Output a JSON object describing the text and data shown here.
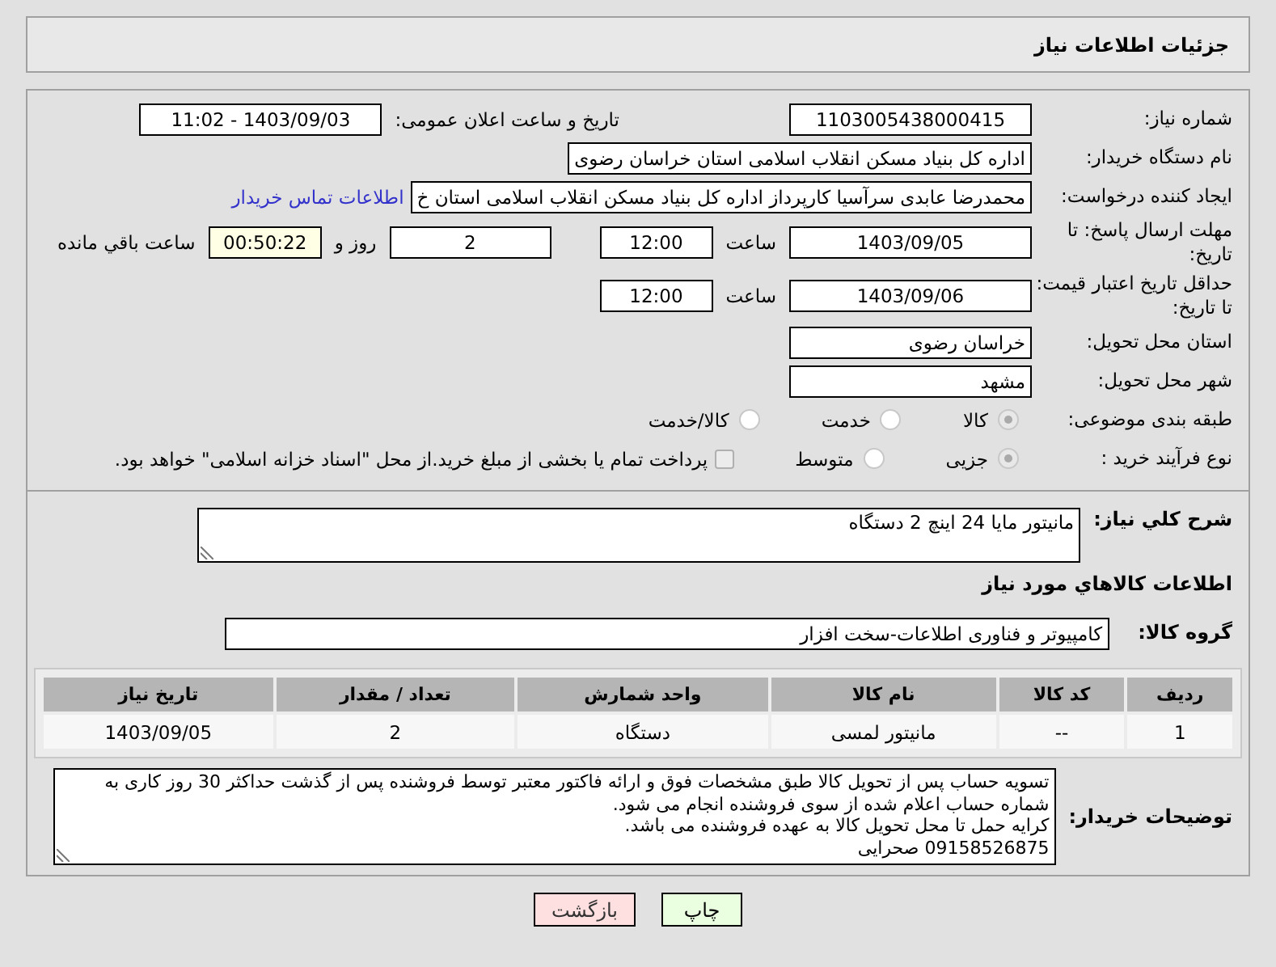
{
  "header": {
    "title": "جزئیات اطلاعات نیاز"
  },
  "need_number": {
    "label": "شماره نیاز:",
    "value": "1103005438000415"
  },
  "announce": {
    "label": "تاریخ و ساعت اعلان عمومی:",
    "value": "1403/09/03 - 11:02"
  },
  "buyer_org": {
    "label": "نام دستگاه خریدار:",
    "value": "اداره کل بنیاد مسکن انقلاب اسلامی استان خراسان رضوی"
  },
  "requester": {
    "label": "ایجاد کننده درخواست:",
    "value": "محمدرضا عابدی سرآسیا کارپرداز اداره کل بنیاد مسکن انقلاب اسلامی استان خ",
    "link": "اطلاعات تماس خریدار"
  },
  "reply_deadline": {
    "label": "مهلت ارسال پاسخ: تا تاریخ:",
    "date": "1403/09/05",
    "time_label": "ساعت",
    "time": "12:00",
    "days": "2",
    "days_label": "روز و",
    "remaining": "00:50:22",
    "remaining_label": "ساعت باقي مانده"
  },
  "price_validity": {
    "label": "حداقل تاریخ اعتبار قیمت: تا تاریخ:",
    "date": "1403/09/06",
    "time_label": "ساعت",
    "time": "12:00"
  },
  "province": {
    "label": "استان محل تحویل:",
    "value": "خراسان رضوی"
  },
  "city": {
    "label": "شهر محل تحویل:",
    "value": "مشهد"
  },
  "category": {
    "label": "طبقه بندی موضوعی:",
    "options": [
      {
        "label": "کالا",
        "selected": true
      },
      {
        "label": "خدمت",
        "selected": false
      },
      {
        "label": "کالا/خدمت",
        "selected": false
      }
    ]
  },
  "process": {
    "label": "نوع فرآیند خرید :",
    "options": [
      {
        "label": "جزیی",
        "selected": true
      },
      {
        "label": "متوسط",
        "selected": false
      }
    ],
    "treasury": {
      "label": "پرداخت تمام یا بخشی از مبلغ خرید.از محل \"اسناد خزانه اسلامی\" خواهد بود.",
      "checked": false
    }
  },
  "description": {
    "label": "شرح کلي نیاز:",
    "value": "مانیتور مایا 24 اینچ 2 دستگاه"
  },
  "items_title": "اطلاعات کالاهاي مورد نیاز",
  "goods_group": {
    "label": "گروه کالا:",
    "value": "کامپیوتر و فناوری اطلاعات-سخت افزار"
  },
  "table": {
    "columns": [
      "ردیف",
      "کد کالا",
      "نام کالا",
      "واحد شمارش",
      "تعداد / مقدار",
      "تاریخ نیاز"
    ],
    "rows": [
      [
        "1",
        "--",
        "مانیتور لمسی",
        "دستگاه",
        "2",
        "1403/09/05"
      ]
    ]
  },
  "buyer_notes": {
    "label": "توضیحات خریدار:",
    "lines": [
      "تسویه حساب پس از تحویل کالا طبق مشخصات فوق و ارائه فاکتور معتبر توسط فروشنده پس از گذشت حداکثر 30 روز کاری به شماره حساب اعلام شده از سوی فروشنده انجام می شود.",
      "کرایه حمل تا محل تحویل کالا به عهده فروشنده می باشد.",
      "09158526875 صحرایی"
    ]
  },
  "buttons": [
    {
      "label": "چاپ",
      "kind": "print"
    },
    {
      "label": "بازگشت",
      "kind": "back"
    }
  ]
}
